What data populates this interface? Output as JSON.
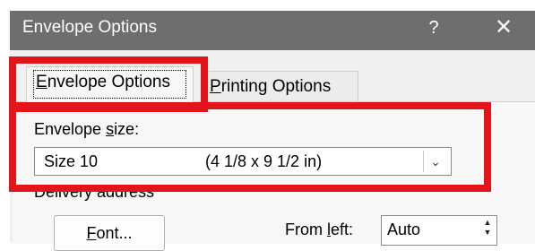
{
  "window": {
    "title": "Envelope Options",
    "help_glyph": "?",
    "close_glyph": "✕"
  },
  "tabs": [
    {
      "label_pre": "",
      "label_u": "E",
      "label_post": "nvelope Options",
      "active": true
    },
    {
      "label_pre": "",
      "label_u": "P",
      "label_post": "rinting Options",
      "active": false
    }
  ],
  "envelope_size": {
    "label_pre": "Envelope ",
    "label_u": "s",
    "label_post": "ize:",
    "selected": "Size 10",
    "dimensions": "(4 1/8 x 9 1/2 in)"
  },
  "delivery": {
    "section_label": "Delivery address",
    "font_pre": "",
    "font_u": "F",
    "font_post": "ont...",
    "from_left_pre": "From ",
    "from_left_u": "l",
    "from_left_post": "eft:",
    "from_left_value": "Auto"
  },
  "colors": {
    "highlight": "#e3151a",
    "titlebar": "#6e6e6e"
  }
}
